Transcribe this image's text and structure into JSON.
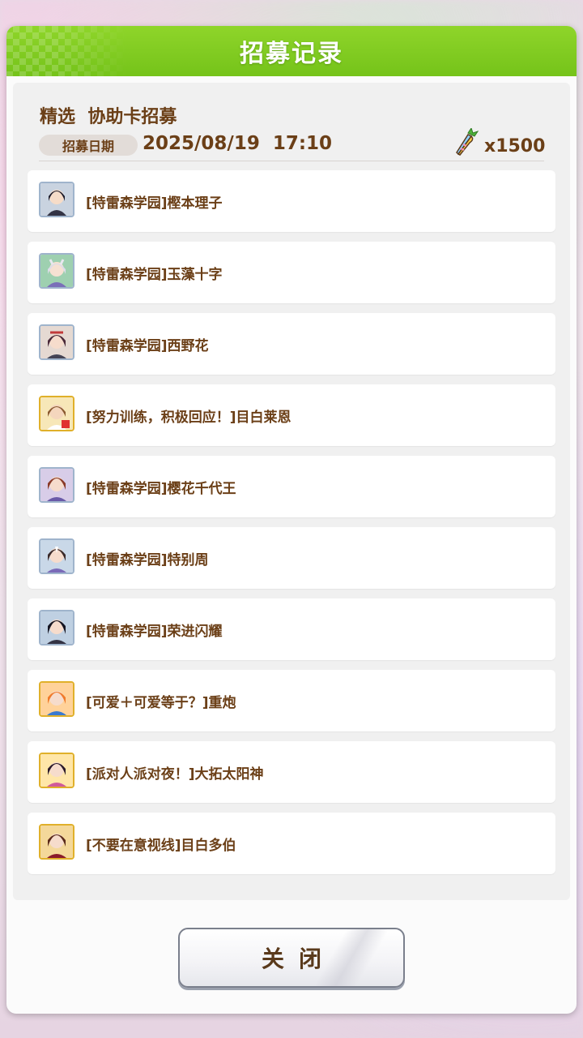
{
  "dialog": {
    "title": "招募记录",
    "banner_name": "精选  协助卡招募",
    "date_label": "招募日期",
    "date_value": "2025/08/19  17:10",
    "cost_icon": "carrot-icon",
    "cost_value": "x1500"
  },
  "records": [
    {
      "label": "[特雷森学园]樫本理子",
      "rarity": "silver",
      "icon": "portrait-icon"
    },
    {
      "label": "[特雷森学园]玉藻十字",
      "rarity": "silver",
      "icon": "portrait-icon"
    },
    {
      "label": "[特雷森学园]西野花",
      "rarity": "silver",
      "icon": "portrait-icon"
    },
    {
      "label": "[努力训练，积极回应！]目白莱恩",
      "rarity": "gold",
      "icon": "portrait-icon"
    },
    {
      "label": "[特雷森学园]樱花千代王",
      "rarity": "silver",
      "icon": "portrait-icon"
    },
    {
      "label": "[特雷森学园]特别周",
      "rarity": "silver",
      "icon": "portrait-icon"
    },
    {
      "label": "[特雷森学园]荣进闪耀",
      "rarity": "silver",
      "icon": "portrait-icon"
    },
    {
      "label": "[可爱＋可爱等于？]重炮",
      "rarity": "gold",
      "icon": "portrait-icon"
    },
    {
      "label": "[派对人派对夜！]大拓太阳神",
      "rarity": "gold",
      "icon": "portrait-icon"
    },
    {
      "label": "[不要在意视线]目白多伯",
      "rarity": "gold",
      "icon": "portrait-icon"
    }
  ],
  "close_button": {
    "label": "关闭"
  },
  "colors": {
    "header_green": "#7bc71f",
    "text_brown": "#6b3f17",
    "silver_frame": "#9fb4cc",
    "gold_frame": "#e0b02a"
  }
}
